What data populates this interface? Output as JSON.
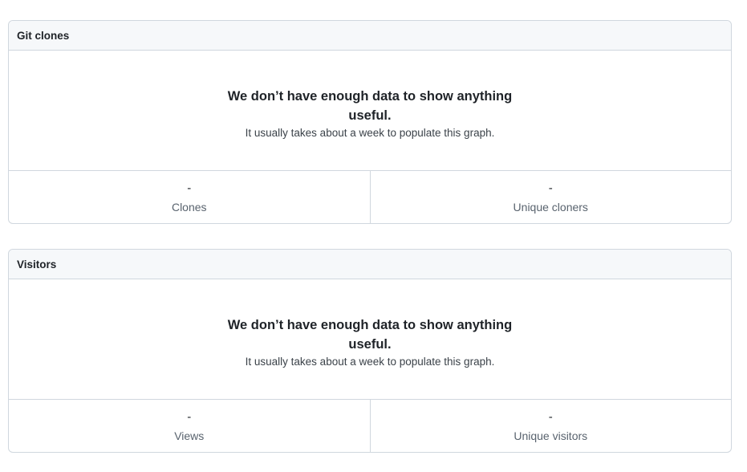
{
  "clones": {
    "title": "Git clones",
    "empty_title": "We don’t have enough data to show anything useful.",
    "empty_subtitle": "It usually takes about a week to populate this graph.",
    "stats": [
      {
        "value": "-",
        "label": "Clones"
      },
      {
        "value": "-",
        "label": "Unique cloners"
      }
    ]
  },
  "visitors": {
    "title": "Visitors",
    "empty_title": "We don’t have enough data to show anything useful.",
    "empty_subtitle": "It usually takes about a week to populate this graph.",
    "stats": [
      {
        "value": "-",
        "label": "Views"
      },
      {
        "value": "-",
        "label": "Unique visitors"
      }
    ]
  }
}
